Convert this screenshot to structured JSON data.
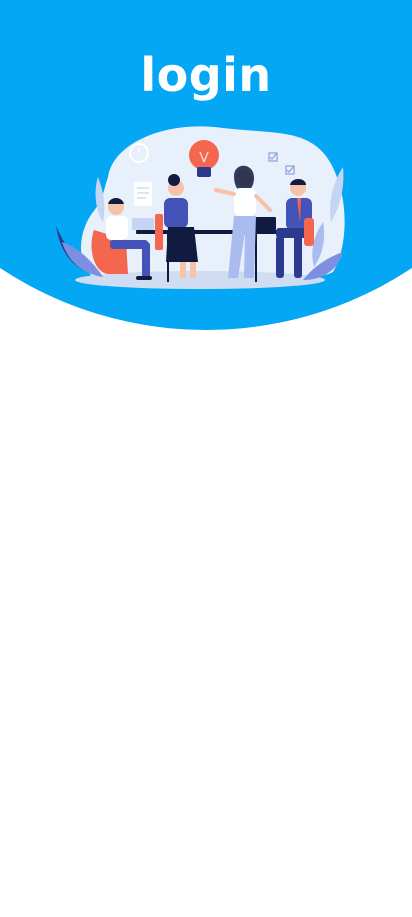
{
  "header": {
    "title": "login",
    "accent_color": "#03a7f4"
  },
  "illustration": {
    "icon": "team-meeting-illustration"
  }
}
